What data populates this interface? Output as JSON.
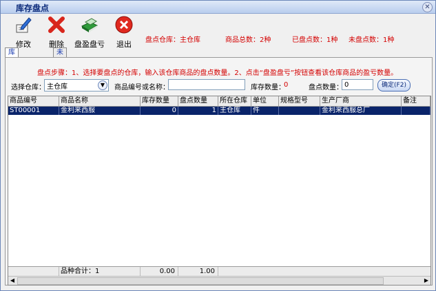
{
  "window": {
    "title": "库存盘点",
    "close_glyph": "✕"
  },
  "toolbar": {
    "edit_label": "修改",
    "delete_label": "删除",
    "surplus_label": "盘盈盘亏",
    "exit_label": "退出"
  },
  "stats": {
    "warehouse": "盘点仓库：主仓库",
    "product_total": "商品总数：2种",
    "counted": "已盘点数：1种",
    "uncounted": "未盘点数：1种"
  },
  "tabs": [
    {
      "label": "库存盘点输入",
      "active": true
    },
    {
      "label": "未盘商品查询",
      "active": false
    }
  ],
  "hint": "盘点步骤：1、选择要盘点的仓库，输入该仓库商品的盘点数量。2、点击“盘盈盘亏”按钮查看该仓库商品的盈亏数量。",
  "form": {
    "warehouse_label": "选择仓库：",
    "warehouse_value": "主仓库",
    "search_label": "商品编号或名称：",
    "search_value": "",
    "stock_label": "库存数量：",
    "stock_value": "0",
    "count_label": "盘点数量：",
    "count_value": "0",
    "confirm_label": "确定(F2)"
  },
  "table": {
    "columns": [
      "商品编号",
      "商品名称",
      "库存数量",
      "盘点数量",
      "所在仓库",
      "单位",
      "规格型号",
      "生产厂商",
      "备注"
    ],
    "rows": [
      {
        "code": "ST00001",
        "name": "金利来西服",
        "stock": "0",
        "count": "1",
        "warehouse": "主仓库",
        "unit": "件",
        "spec": "",
        "maker": "金利来西服总厂",
        "note": ""
      }
    ],
    "footer": {
      "total_label": "品种合计：1",
      "stock_sum": "0.00",
      "count_sum": "1.00"
    }
  },
  "colors": {
    "accent_red": "#d40000",
    "selection": "#0a246a",
    "title_text": "#0b2a7a"
  },
  "icons": [
    "pencil-icon",
    "delete-cross-icon",
    "book-icon",
    "exit-icon",
    "close-icon",
    "chevron-down-icon",
    "arrow-left-icon",
    "arrow-right-icon"
  ]
}
